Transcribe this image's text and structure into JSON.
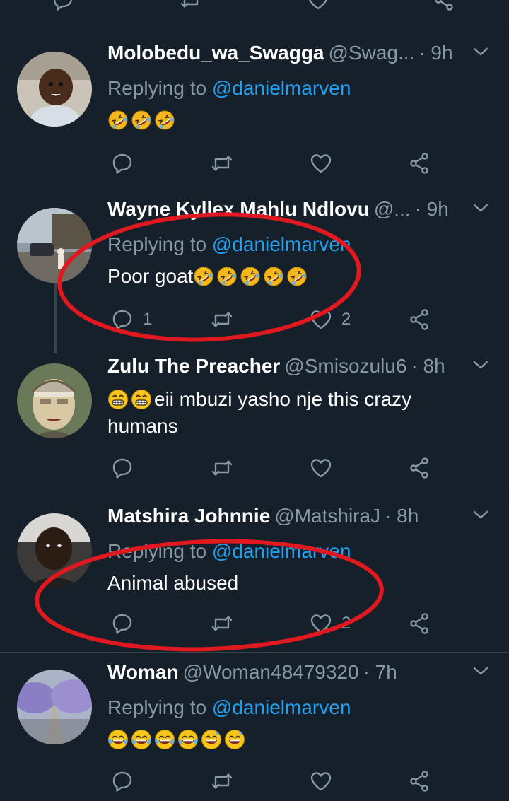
{
  "colors": {
    "background": "#15202b",
    "divider": "#38444d",
    "secondary_text": "#8899a6",
    "mention": "#1da1f2",
    "annotation": "#e0181f"
  },
  "icons": {
    "reply": "reply-icon",
    "retweet": "retweet-icon",
    "like": "heart-icon",
    "share": "share-icon",
    "menu": "chevron-down-icon"
  },
  "tweets": [
    {
      "name": "Molobedu_wa_Swagga",
      "handle": "@Swag...",
      "time": "· 9h",
      "reply_prefix": "Replying to ",
      "reply_to": "@danielmarven",
      "text": "",
      "emojis": [
        "rofl",
        "rofl",
        "rofl"
      ],
      "replies": "",
      "likes": ""
    },
    {
      "name": "Wayne Kyllex Mahlu Ndlovu",
      "handle": "@...",
      "time": "· 9h",
      "reply_prefix": "Replying to ",
      "reply_to": "@danielmarven",
      "text": "Poor goat",
      "emojis": [
        "rofl",
        "rofl",
        "rofl",
        "rofl",
        "rofl"
      ],
      "replies": "1",
      "likes": "2"
    },
    {
      "name": "Zulu The Preacher",
      "handle": "@Smisozulu6",
      "time": "· 8h",
      "text_line1": "eii mbuzi yasho nje this crazy",
      "text_line2": "humans",
      "emojis": [
        "grin",
        "grin"
      ],
      "replies": "",
      "likes": ""
    },
    {
      "name": "Matshira Johnnie",
      "handle": "@MatshiraJ",
      "time": "· 8h",
      "reply_prefix": "Replying to ",
      "reply_to": "@danielmarven",
      "text": "Animal abused",
      "replies": "",
      "likes": "2"
    },
    {
      "name": "Woman",
      "handle": "@Woman48479320",
      "time": "· 7h",
      "reply_prefix": "Replying to ",
      "reply_to": "@danielmarven",
      "emojis": [
        "joy",
        "joy",
        "joy",
        "joy",
        "sweat-smile",
        "sweat-smile"
      ],
      "replies": "",
      "likes": ""
    }
  ]
}
